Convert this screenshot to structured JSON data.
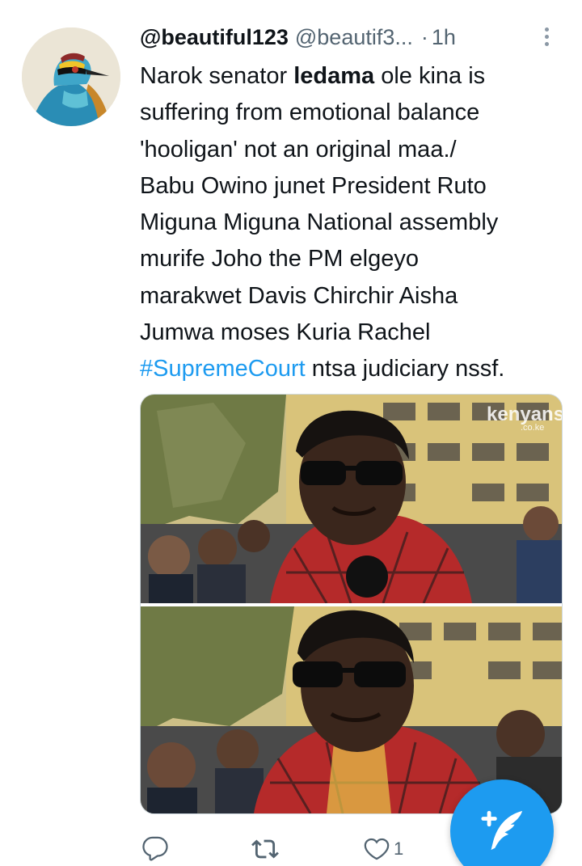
{
  "tweet": {
    "display_name": "@beautiful123",
    "handle": "@beautif3...",
    "separator": "·",
    "time": "1h",
    "avatar_icon": "bird-avatar",
    "text_lines": [
      {
        "segments": [
          {
            "text": "Narok senator "
          },
          {
            "text": "ledama",
            "style": "bold"
          },
          {
            "text": " ole kina is"
          }
        ]
      },
      {
        "segments": [
          {
            "text": "suffering from emotional balance"
          }
        ]
      },
      {
        "segments": [
          {
            "text": "'hooligan' not an original maa./"
          }
        ]
      },
      {
        "segments": [
          {
            "text": "Babu Owino junet President Ruto"
          }
        ]
      },
      {
        "segments": [
          {
            "text": "Miguna Miguna National assembly"
          }
        ]
      },
      {
        "segments": [
          {
            "text": "murife Joho the PM elgeyo"
          }
        ]
      },
      {
        "segments": [
          {
            "text": "marakwet Davis Chirchir Aisha"
          }
        ]
      },
      {
        "segments": [
          {
            "text": "Jumwa moses Kuria Rachel"
          }
        ]
      },
      {
        "segments": [
          {
            "text": "#SupremeCourt",
            "style": "hashtag"
          },
          {
            "text": " ntsa judiciary nssf."
          }
        ]
      }
    ],
    "media_watermark": "kenyans",
    "media_watermark_domain": ".co.ke",
    "actions": {
      "reply_icon": "reply-icon",
      "retweet_icon": "retweet-icon",
      "like_icon": "heart-icon",
      "like_count": "1"
    }
  },
  "compose_button": {
    "icon": "compose-feather-plus-icon"
  },
  "colors": {
    "accent": "#1d9bf0",
    "text": "#0f1419",
    "secondary": "#536471"
  }
}
